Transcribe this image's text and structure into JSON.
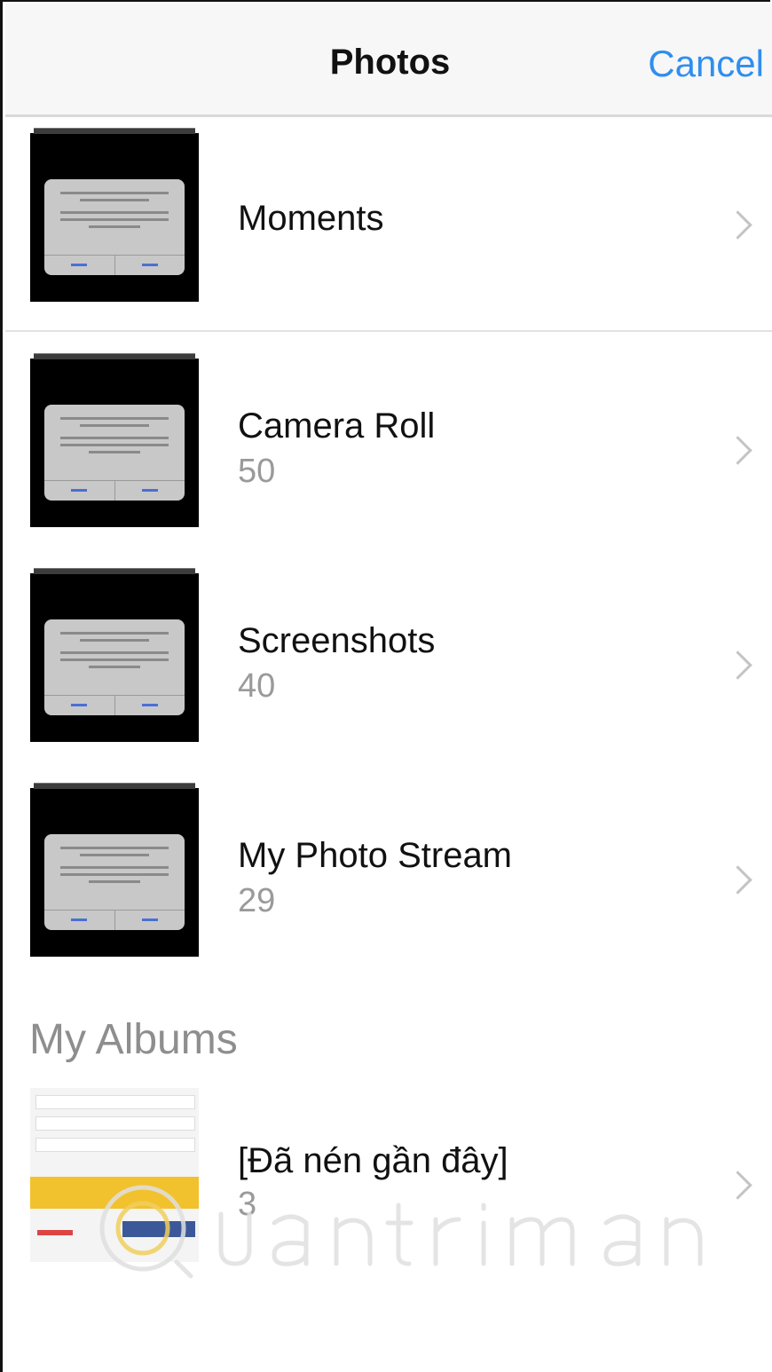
{
  "nav": {
    "title": "Photos",
    "cancel_label": "Cancel"
  },
  "rows": [
    {
      "title": "Moments",
      "count": ""
    },
    {
      "title": "Camera Roll",
      "count": "50"
    },
    {
      "title": "Screenshots",
      "count": "40"
    },
    {
      "title": "My Photo Stream",
      "count": "29"
    }
  ],
  "my_albums": {
    "header": "My Albums",
    "items": [
      {
        "title": "[Đã nén gần đây]",
        "count": "3"
      }
    ]
  },
  "icons": {
    "row_chevron": "chevron-right-icon"
  },
  "colors": {
    "accent": "#2e8ff0",
    "secondary_text": "#9a9a9a",
    "chevron": "#c4c4c7"
  }
}
